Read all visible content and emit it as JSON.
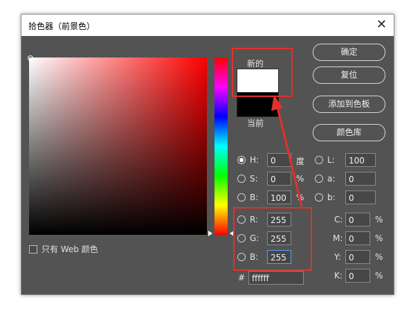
{
  "dialog": {
    "title": "拾色器（前景色）",
    "close_glyph": "✕"
  },
  "swatches": {
    "new_label": "新的",
    "current_label": "当前"
  },
  "buttons": {
    "ok": "确定",
    "reset": "复位",
    "add_to_swatches": "添加到色板",
    "color_libraries": "颜色库"
  },
  "web_only": {
    "label": "只有 Web 颜色",
    "checked": false
  },
  "hsb": {
    "h": {
      "label": "H:",
      "value": "0",
      "unit": "度",
      "selected": true
    },
    "s": {
      "label": "S:",
      "value": "0",
      "unit": "%"
    },
    "b": {
      "label": "B:",
      "value": "100",
      "unit": "%"
    }
  },
  "lab": {
    "l": {
      "label": "L:",
      "value": "100"
    },
    "a": {
      "label": "a:",
      "value": "0"
    },
    "b": {
      "label": "b:",
      "value": "0"
    }
  },
  "rgb": {
    "r": {
      "label": "R:",
      "value": "255"
    },
    "g": {
      "label": "G:",
      "value": "255"
    },
    "b": {
      "label": "B:",
      "value": "255"
    }
  },
  "cmyk": {
    "c": {
      "label": "C:",
      "value": "0",
      "unit": "%"
    },
    "m": {
      "label": "M:",
      "value": "0",
      "unit": "%"
    },
    "y": {
      "label": "Y:",
      "value": "0",
      "unit": "%"
    },
    "k": {
      "label": "K:",
      "value": "0",
      "unit": "%"
    }
  },
  "hex": {
    "label": "#",
    "value": "ffffff"
  },
  "colors": {
    "dialog_bg": "#535353",
    "annotation_red": "#e5302a",
    "new_color": "#ffffff",
    "current_color": "#000000"
  }
}
